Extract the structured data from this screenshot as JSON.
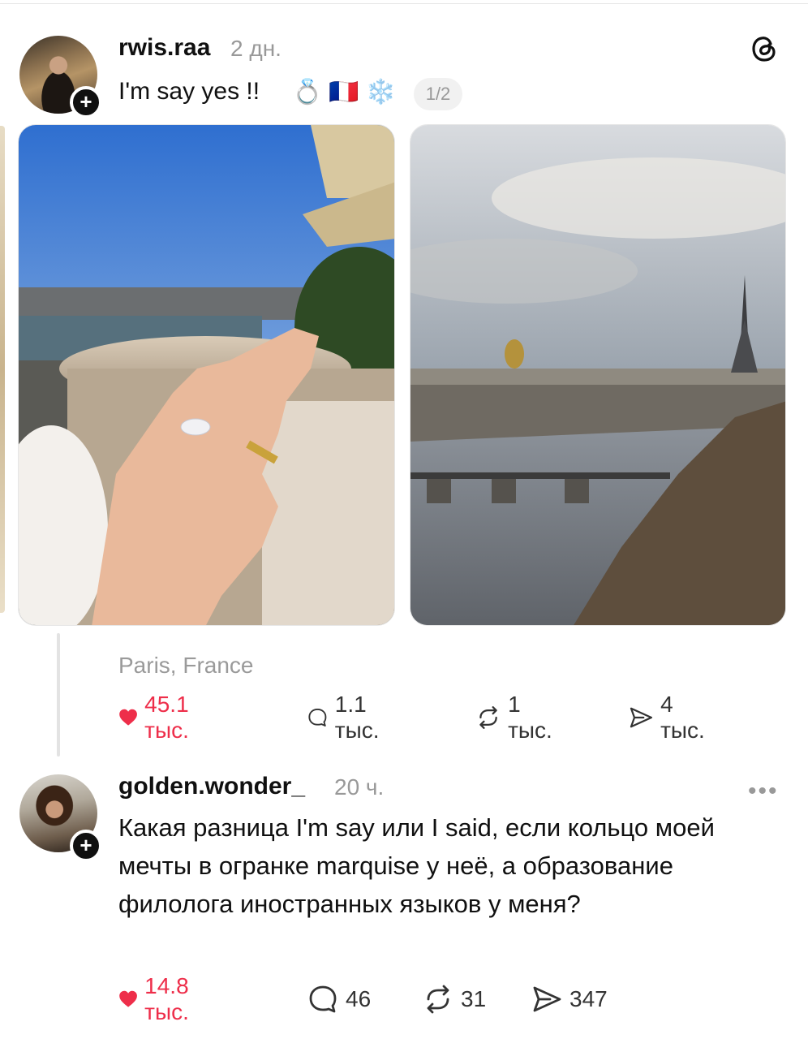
{
  "post": {
    "username": "rwis.raa",
    "time": "2 дн.",
    "caption": "I'm say yes !!",
    "emojis": [
      "💍",
      "🇫🇷",
      "❄️"
    ],
    "pager": "1/2",
    "location": "Paris, France",
    "stats": {
      "likes": "45.1 тыс.",
      "replies": "1.1 тыс.",
      "reposts": "1 тыс.",
      "shares": "4 тыс."
    }
  },
  "reply": {
    "username": "golden.wonder_",
    "time": "20 ч.",
    "text": "Какая разница I'm say или I said, если кольцо моей мечты в огранке marquise у неё, а образование филолога иностранных языков у меня?",
    "more": "•••",
    "stats": {
      "likes": "14.8 тыс.",
      "replies": "46",
      "reposts": "31",
      "shares": "347"
    }
  },
  "icons": {
    "header": "threads-icon",
    "like": "heart-icon",
    "reply": "comment-icon",
    "repost": "repost-icon",
    "share": "send-icon",
    "follow": "plus-icon"
  },
  "colors": {
    "liked": "#ee2e4a",
    "muted": "#999999",
    "text": "#101010"
  }
}
